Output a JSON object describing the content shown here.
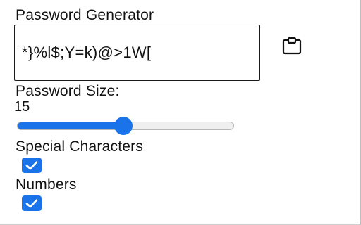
{
  "title": "Password Generator",
  "password": {
    "value": "*}%l$;Y=k)@>1W["
  },
  "copy_button": {
    "icon": "clipboard-icon"
  },
  "password_size": {
    "label": "Password Size:",
    "value": "15",
    "slider_fraction": 0.49
  },
  "options": {
    "special_characters": {
      "label": "Special Characters",
      "checked": true
    },
    "numbers": {
      "label": "Numbers",
      "checked": true
    }
  },
  "colors": {
    "accent": "#1a73e8",
    "text": "#111111",
    "track": "#efefef"
  }
}
